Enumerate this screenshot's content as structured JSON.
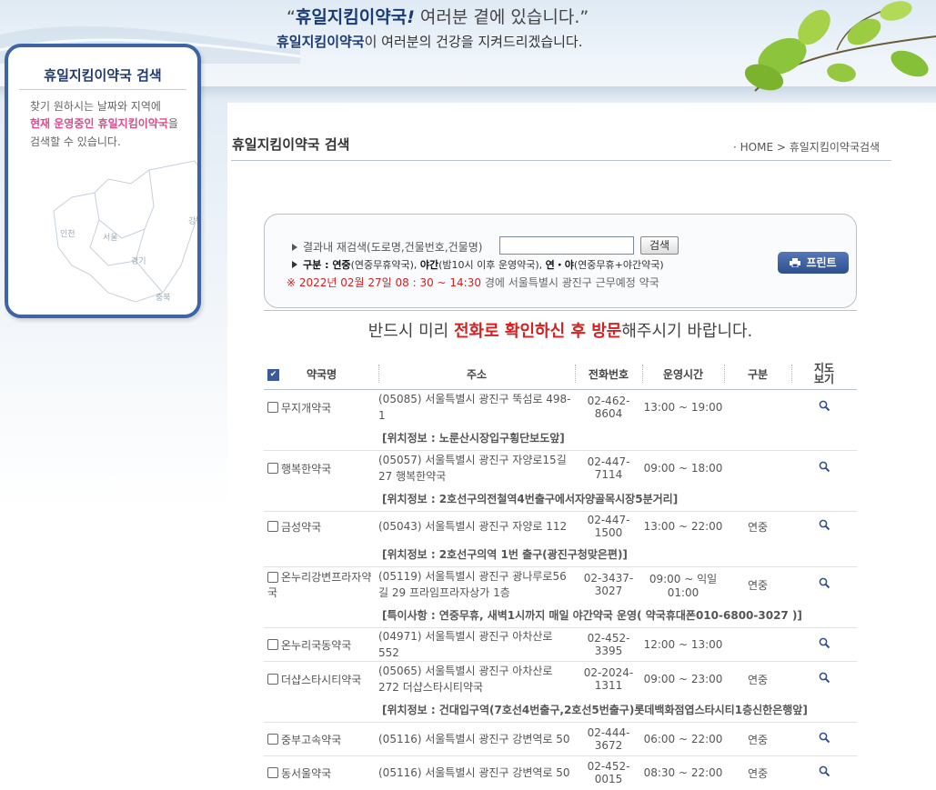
{
  "header": {
    "slogan_brand": "휴일지킴이약국",
    "slogan_rest": " 여러분 곁에 있습니다.",
    "subslogan_brand": "휴일지킴이약국",
    "subslogan_rest": "이 여러분의 건강을 지켜드리겠습니다."
  },
  "sidebar": {
    "title": "휴일지킴이약국 검색",
    "desc_line1": "찾기 원하시는 날짜와 지역에",
    "desc_line2_red": "현재 운영중인 휴일지킴이약국",
    "desc_line2_rest": "을",
    "desc_line3": "검색할 수 있습니다.",
    "map_labels": [
      "인천",
      "서울",
      "강원",
      "경기",
      "충북"
    ]
  },
  "page": {
    "title": "휴일지킴이약국 검색",
    "breadcrumb": "· HOME > 휴일지킴이약국검색"
  },
  "search": {
    "label": "결과내 재검색(도로명,건물번호,건물명)",
    "input_value": "",
    "button": "검색",
    "legend_prefix": "구분 : ",
    "legend_items": [
      {
        "term": "연중",
        "desc": "(연중무휴약국), "
      },
      {
        "term": "야간",
        "desc": "(밤10시 이후 운영약국), "
      },
      {
        "term": "연・야",
        "desc": "(연중무휴+야간약국)"
      }
    ],
    "time_red": "※ 2022년 02월 27일 08 : 30 ~ 14:30",
    "time_rest": " 경에  서울특별시  광진구   근무예정 약국",
    "print_button": "프린트"
  },
  "notice": {
    "pre": "반드시 미리 ",
    "red": "전화로 확인하신 후 방문",
    "post": "해주시기 바랍니다."
  },
  "table": {
    "headers": {
      "name": "약국명",
      "address": "주소",
      "phone": "전화번호",
      "hours": "운영시간",
      "type": "구분",
      "map": "지도보기"
    },
    "rows": [
      {
        "name": "무지개약국",
        "address": "(05085) 서울특별시 광진구 뚝섬로 498-1",
        "phone": "02-462-8604",
        "hours": "13:00 ~ 19:00",
        "type": "",
        "info": "[위치정보 : 노룬산시장입구횡단보도앞]"
      },
      {
        "name": "행복한약국",
        "address": "(05057) 서울특별시 광진구 자양로15길 27 행복한약국",
        "phone": "02-447-7114",
        "hours": "09:00 ~ 18:00",
        "type": "",
        "info": "[위치정보 : 2호선구의전철역4번출구에서자양골목시장5분거리]"
      },
      {
        "name": "금성약국",
        "address": "(05043) 서울특별시 광진구 자양로 112",
        "phone": "02-447-1500",
        "hours": "13:00 ~ 22:00",
        "type": "연중",
        "info": "[위치정보 : 2호선구의역 1번 출구(광진구청맞은편)]"
      },
      {
        "name": "온누리강변프라자약국",
        "address": "(05119) 서울특별시 광진구 광나루로56길 29 프라임프라자상가 1층",
        "phone": "02-3437-3027",
        "hours": "09:00 ~ 익일 01:00",
        "type": "연중",
        "info": "[특이사항 : 연중무휴, 새벽1시까지 매일 야간약국 운영( 약국휴대폰010-6800-3027 )]"
      },
      {
        "name": "온누리국동약국",
        "address": "(04971) 서울특별시 광진구 아차산로 552",
        "phone": "02-452-3395",
        "hours": "12:00 ~ 13:00",
        "type": "",
        "info": ""
      },
      {
        "name": "더샵스타시티약국",
        "address": "(05065) 서울특별시 광진구 아차산로 272 더샵스타시티약국",
        "phone": "02-2024-1311",
        "hours": "09:00 ~ 23:00",
        "type": "연중",
        "info": "[위치정보 : 건대입구역(7호선4번출구,2호선5번출구)롯데백화점엽스타시티1층신한은행앞]"
      },
      {
        "name": "중부고속약국",
        "address": "(05116) 서울특별시 광진구 강변역로 50",
        "phone": "02-444-3672",
        "hours": "06:00 ~ 22:00",
        "type": "연중",
        "info": ""
      },
      {
        "name": "동서울약국",
        "address": "(05116) 서울특별시 광진구 강변역로 50",
        "phone": "02-452-0015",
        "hours": "08:30 ~ 22:00",
        "type": "연중",
        "info": ""
      }
    ]
  }
}
